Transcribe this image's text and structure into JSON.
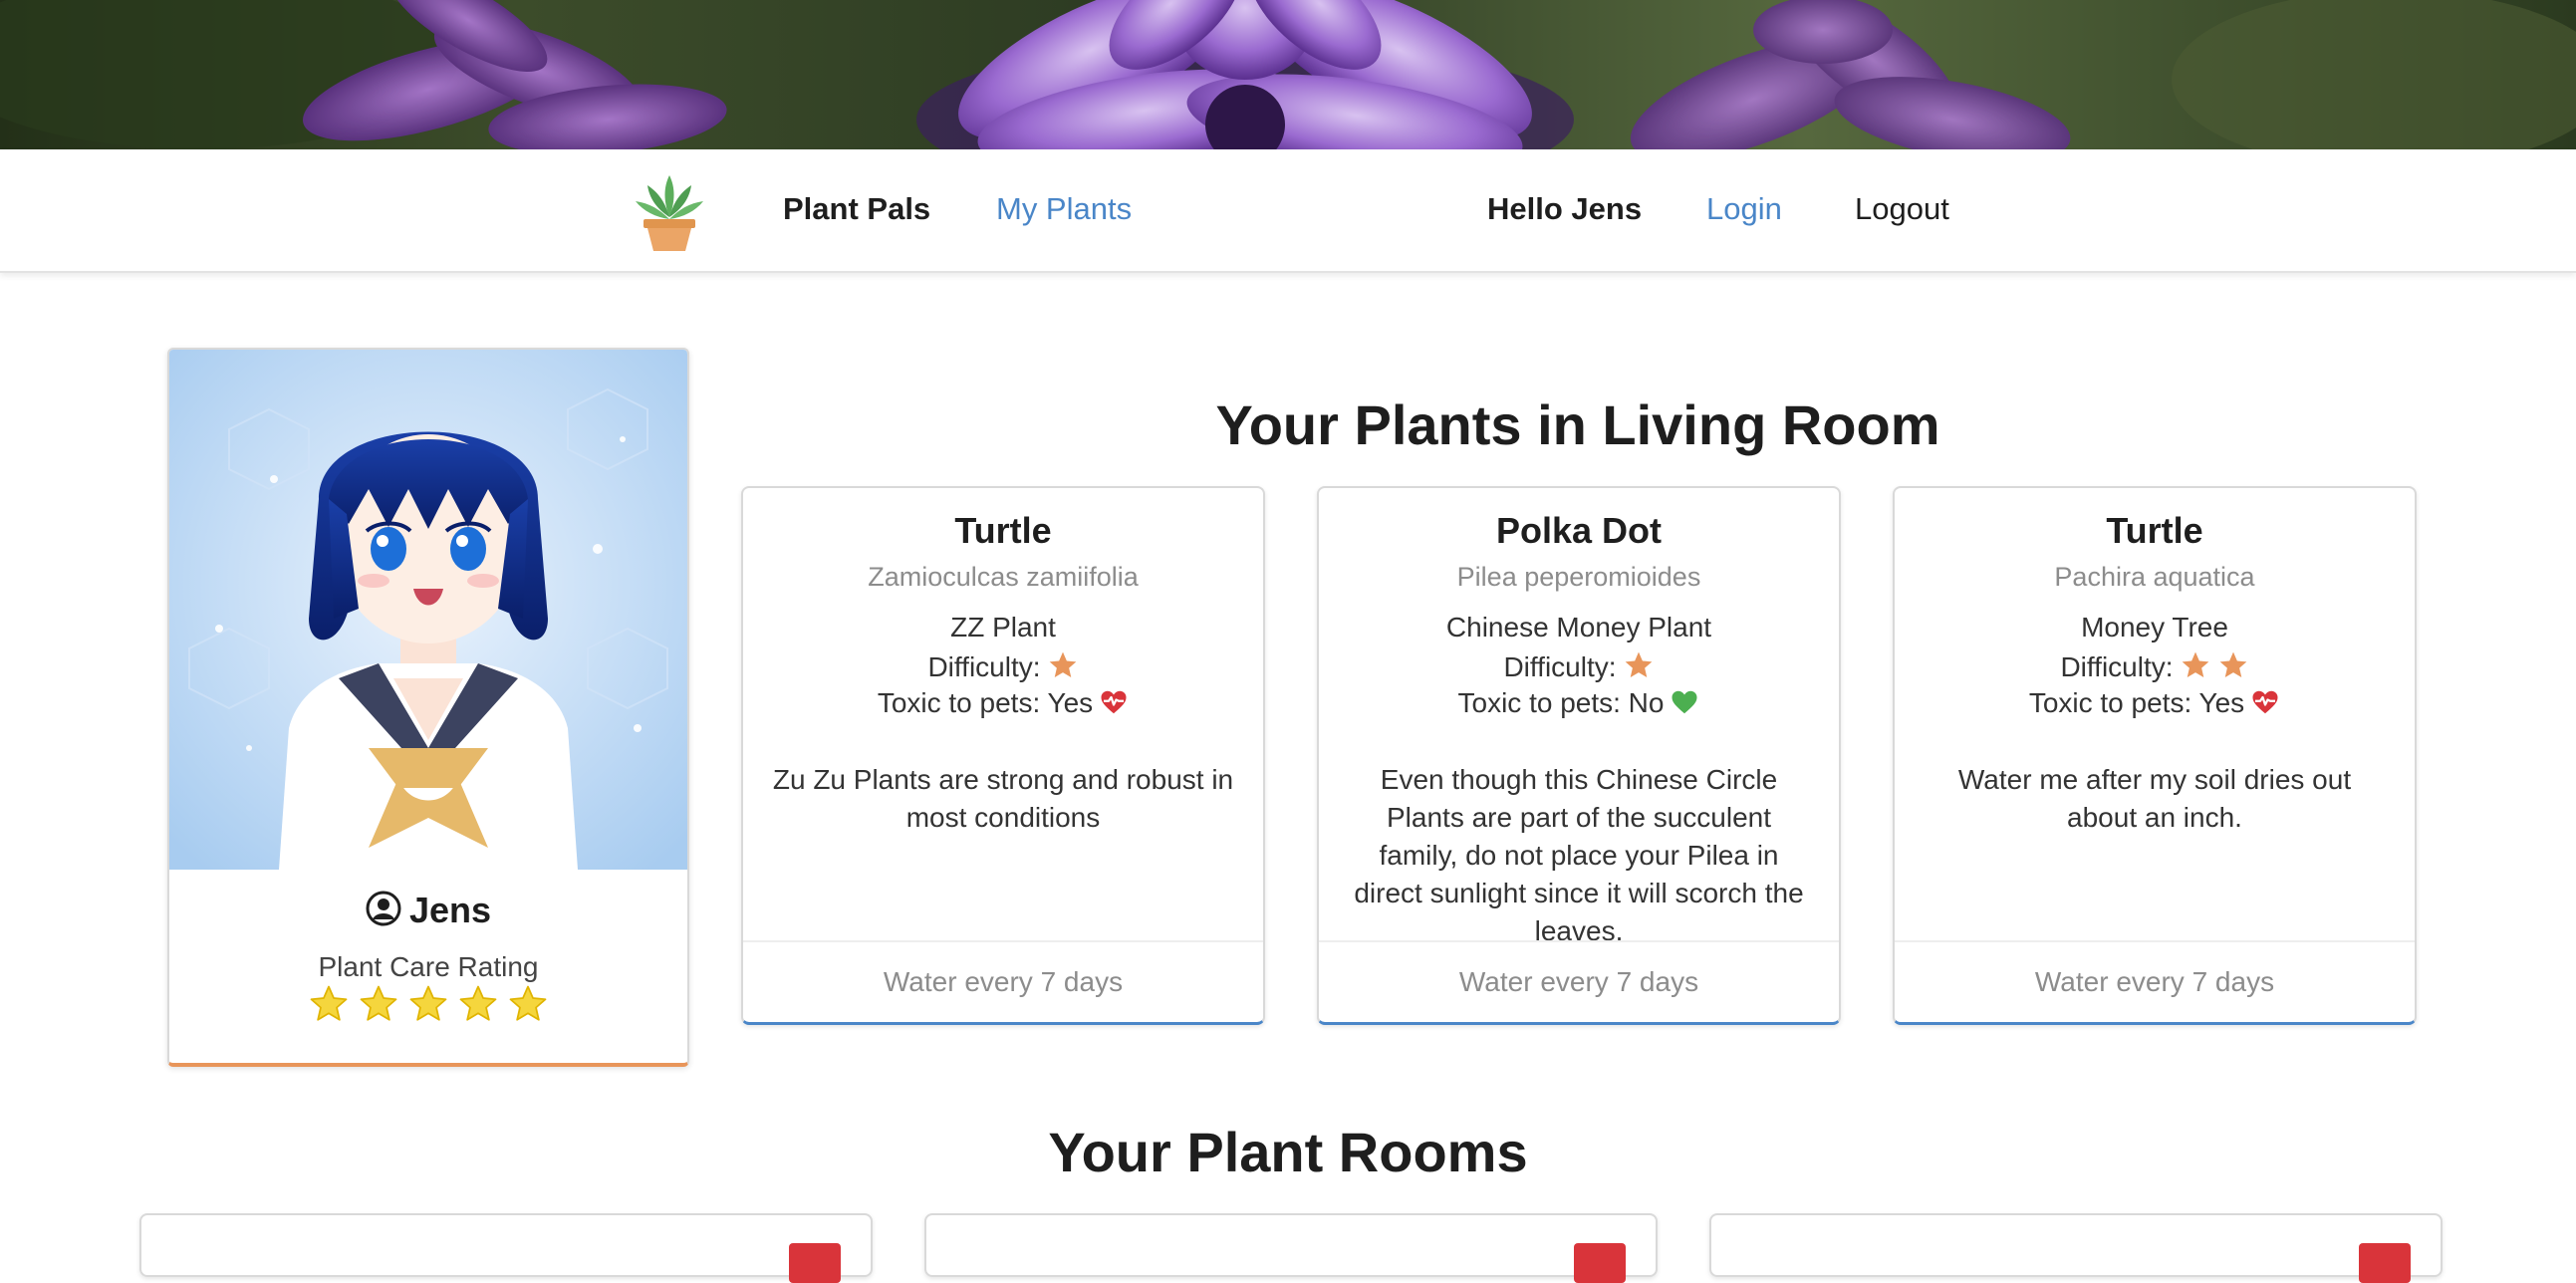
{
  "navbar": {
    "brand": "Plant Pals",
    "my_plants": "My Plants",
    "greeting": "Hello Jens",
    "login": "Login",
    "logout": "Logout"
  },
  "profile": {
    "name": "Jens",
    "rating_label": "Plant Care Rating",
    "rating": 5,
    "rating_max": 5
  },
  "living_room": {
    "title": "Your Plants in Living Room",
    "plants": [
      {
        "name": "Turtle",
        "scientific_name": "Zamioculcas zamiifolia",
        "common_name": "ZZ Plant",
        "difficulty_label": "Difficulty:",
        "difficulty": 1,
        "toxic_label": "Toxic to pets: Yes",
        "toxic": true,
        "description": "Zu Zu Plants are strong and robust in most conditions",
        "watering": "Water every 7 days"
      },
      {
        "name": "Polka Dot",
        "scientific_name": "Pilea peperomioides",
        "common_name": "Chinese Money Plant",
        "difficulty_label": "Difficulty:",
        "difficulty": 1,
        "toxic_label": "Toxic to pets: No",
        "toxic": false,
        "description": "Even though this Chinese Circle Plants are part of the succulent family, do not place your Pilea in direct sunlight since it will scorch the leaves.",
        "watering": "Water every 7 days"
      },
      {
        "name": "Turtle",
        "scientific_name": "Pachira aquatica",
        "common_name": "Money Tree",
        "difficulty_label": "Difficulty:",
        "difficulty": 2,
        "toxic_label": "Toxic to pets: Yes",
        "toxic": true,
        "description": "Water me after my soil dries out about an inch.",
        "watering": "Water every 7 days"
      }
    ]
  },
  "rooms": {
    "title": "Your Plant Rooms",
    "count_visible": 3
  },
  "colors": {
    "link": "#4a86c8",
    "difficulty_star": "#e8955a",
    "rating_star": "#f5d63d",
    "toxic_heart": "#d9343a",
    "safe_heart": "#4caf50",
    "delete_button": "#d9343a"
  },
  "icons": {
    "logo": "succulent-pot-icon",
    "user": "user-circle-icon",
    "difficulty": "star-icon",
    "toxic": "heartbeat-icon",
    "safe": "green-heart-icon",
    "delete": "trash-icon"
  }
}
